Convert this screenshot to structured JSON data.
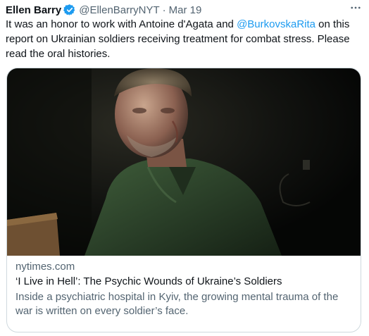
{
  "tweet": {
    "author_name": "Ellen Barry",
    "handle": "@EllenBarryNYT",
    "separator": "·",
    "date": "Mar 19",
    "text_1": "It was an honor to work with Antoine d'Agata and ",
    "mention": "@BurkovskaRita",
    "text_2": " on this report on Ukrainian soldiers receiving treatment for combat stress. Please read the oral histories."
  },
  "card": {
    "domain": "nytimes.com",
    "title": "‘I Live in Hell’: The Psychic Wounds of Ukraine’s Soldiers",
    "description": "Inside a psychiatric hospital in Kyiv, the growing mental trauma of the war is written on every soldier’s face."
  },
  "colors": {
    "link": "#1d9bf0",
    "secondary_text": "#536471",
    "border": "#cfd9de"
  },
  "icons": {
    "verified": "verified-badge-icon",
    "more": "more-horizontal-icon"
  }
}
